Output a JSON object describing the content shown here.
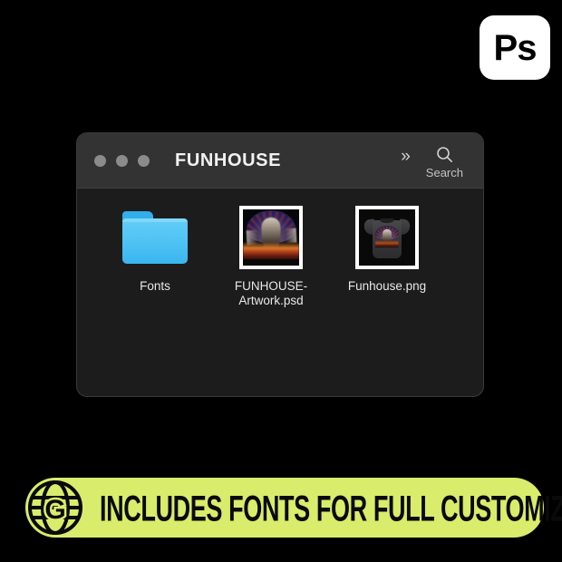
{
  "app_badge": {
    "name": "photoshop-badge",
    "label": "Ps",
    "bg_color": "#ffffff",
    "text_color": "#000000"
  },
  "finder_window": {
    "title": "FUNHOUSE",
    "titlebar": {
      "traffic_lights": [
        "close",
        "minimize",
        "zoom"
      ],
      "more_icon": "chevron-double-right-icon",
      "more_label": "»",
      "search_icon": "search-icon",
      "search_label": "Search"
    },
    "colors": {
      "titlebar_bg": "#333334",
      "body_bg": "#1c1c1c",
      "border": "#3a3a3a",
      "label_text": "#e8e8e8"
    },
    "files": [
      {
        "name": "Fonts",
        "kind": "folder",
        "icon": "blue-folder-icon"
      },
      {
        "name": "FUNHOUSE-Artwork.psd",
        "kind": "photoshop-document",
        "icon": "artwork-thumbnail"
      },
      {
        "name": "Funhouse.png",
        "kind": "image",
        "icon": "tshirt-thumbnail"
      }
    ]
  },
  "banner": {
    "text": "INCLUDES FONTS FOR FULL CUSTOMIZATION",
    "icon": "globe-g-icon",
    "icon_letter": "G",
    "bg_color": "#d9ec6b",
    "text_color": "#0a0a0a"
  },
  "page": {
    "background": "#000000"
  }
}
